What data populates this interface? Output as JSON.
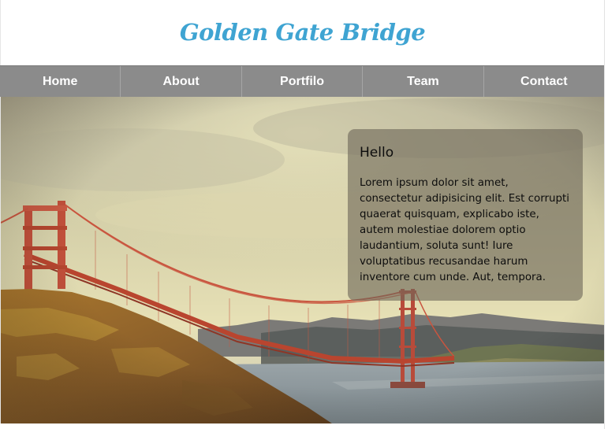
{
  "header": {
    "title": "Golden Gate Bridge",
    "title_color": "#3fa4d2"
  },
  "nav": {
    "items": [
      {
        "label": "Home"
      },
      {
        "label": "About"
      },
      {
        "label": "Portfilo"
      },
      {
        "label": "Team"
      },
      {
        "label": "Contact"
      }
    ]
  },
  "hero": {
    "image": "golden-gate-bridge-photo"
  },
  "panel": {
    "title": "Hello",
    "body": "Lorem ipsum dolor sit amet, consectetur adipisicing elit. Est corrupti quaerat quisquam, explicabo iste, autem molestiae dolorem optio laudantium, soluta sunt! Iure voluptatibus recusandae harum inventore cum unde. Aut, tempora."
  }
}
